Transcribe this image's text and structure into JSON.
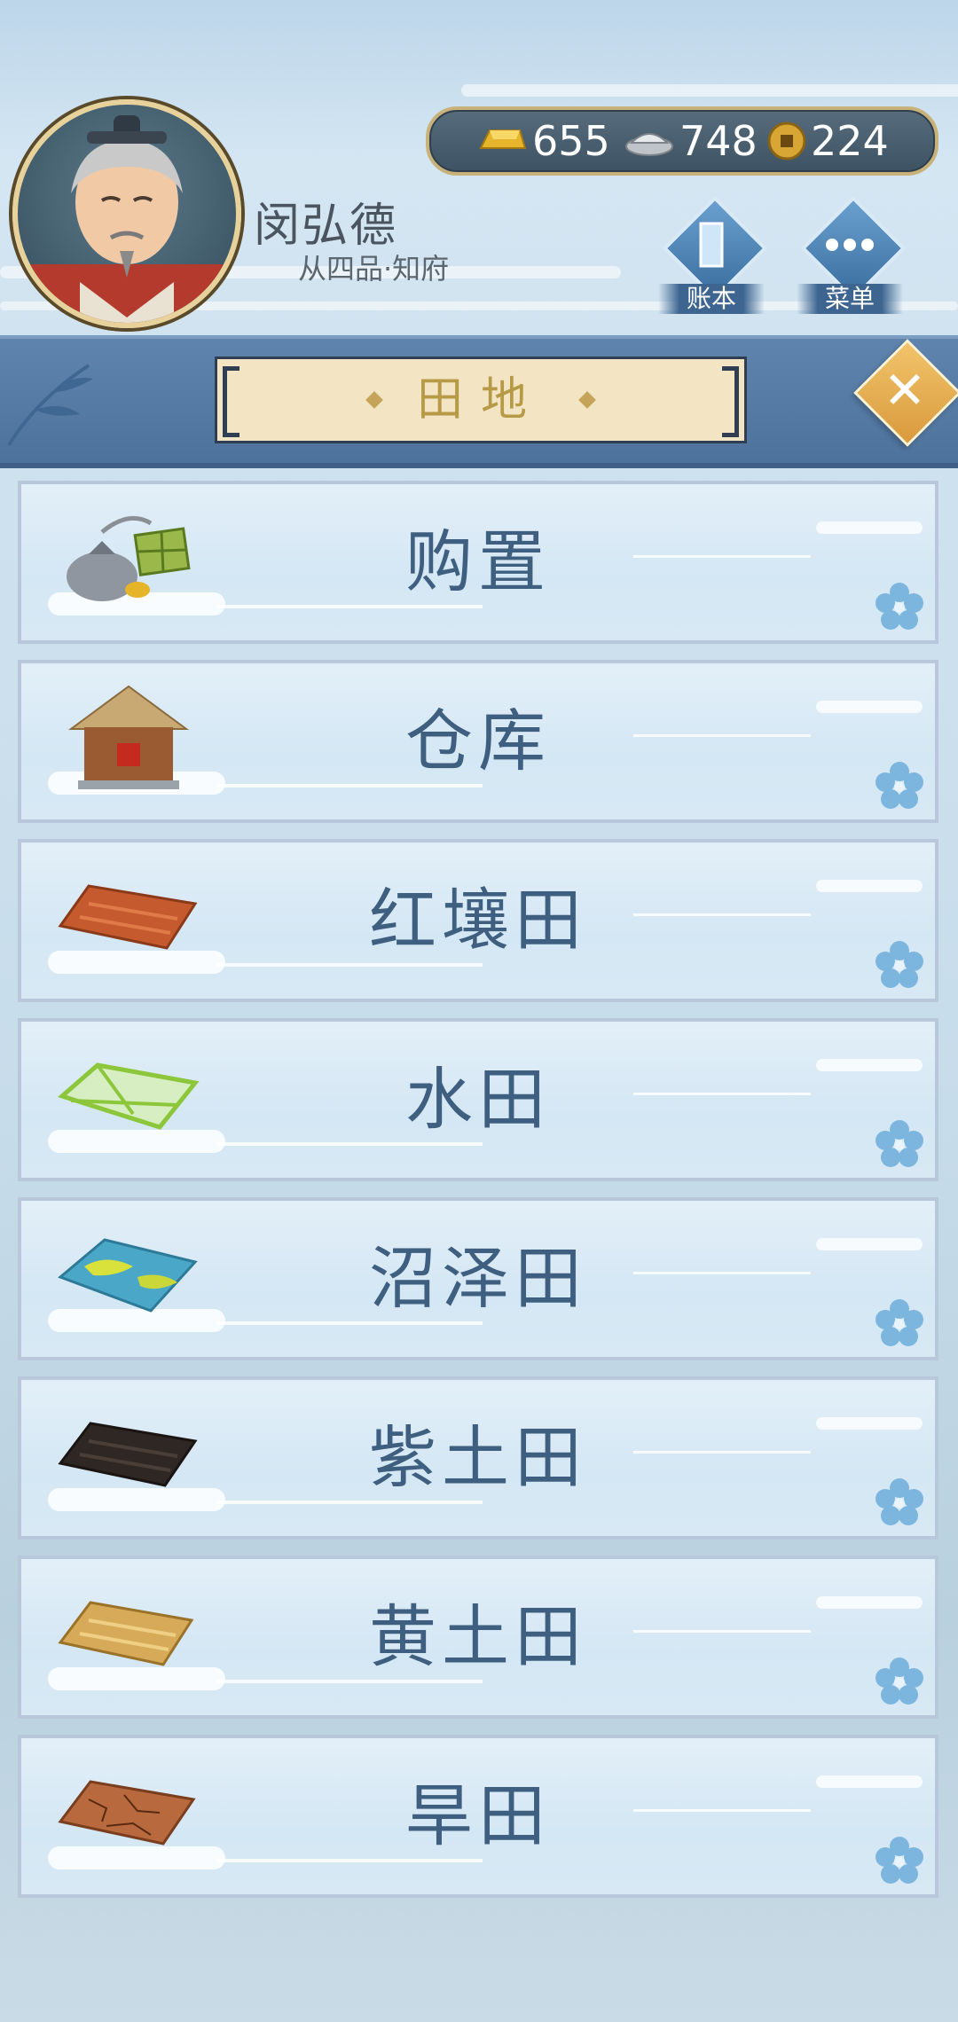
{
  "header": {
    "player_name": "闵弘德",
    "player_rank": "从四品·知府",
    "currency": [
      {
        "icon": "gold-ingot-icon",
        "value": "655"
      },
      {
        "icon": "silver-ingot-icon",
        "value": "748"
      },
      {
        "icon": "copper-coin-icon",
        "value": "224"
      }
    ],
    "ledger_label": "账本",
    "menu_label": "菜单"
  },
  "panel": {
    "title": "田地",
    "close_icon": "close-icon"
  },
  "items": [
    {
      "label": "购置",
      "icon": "purchase-bag-icon"
    },
    {
      "label": "仓库",
      "icon": "warehouse-hut-icon"
    },
    {
      "label": "红壤田",
      "icon": "red-soil-field-icon"
    },
    {
      "label": "水田",
      "icon": "paddy-field-icon"
    },
    {
      "label": "沼泽田",
      "icon": "marsh-field-icon"
    },
    {
      "label": "紫土田",
      "icon": "purple-soil-field-icon"
    },
    {
      "label": "黄土田",
      "icon": "yellow-soil-field-icon"
    },
    {
      "label": "旱田",
      "icon": "dry-field-icon"
    }
  ],
  "colors": {
    "accent_blue": "#4d729c",
    "label_text": "#3f5f80",
    "title_gold": "#b69a45"
  }
}
